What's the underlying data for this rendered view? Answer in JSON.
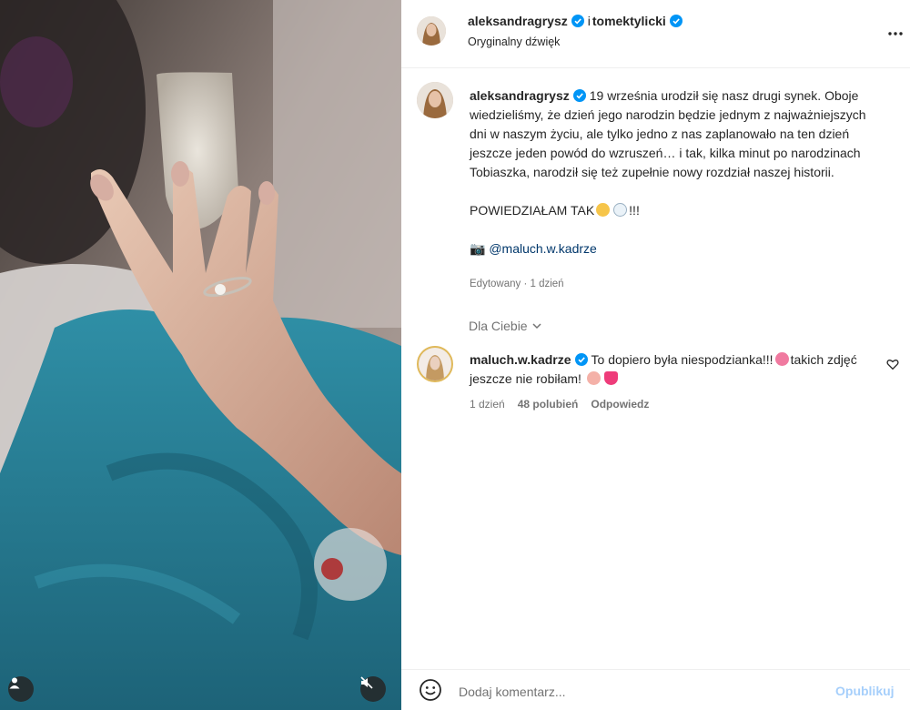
{
  "post": {
    "author": "aleksandragrysz",
    "conjunction": "i",
    "coauthor": "tomektylicki",
    "audio": "Oryginalny dźwięk"
  },
  "caption": {
    "author": "aleksandragrysz",
    "paragraph1": "19 września urodził się nasz drugi synek. Oboje wiedzieliśmy, że dzień jego narodzin będzie jednym z najważniejszych dni w naszym życiu, ale tylko jedno z nas zaplanowało na ten dzień jeszcze jeden powód do wzruszeń… i tak, kilka minut po narodzinach Tobiaszka, narodził się też zupełnie nowy rozdział naszej historii.",
    "paragraph2": "POWIEDZIAŁAM TAK",
    "paragraph2_end": "!!!",
    "camera_emoji": "📷",
    "mention": "@maluch.w.kadrze",
    "edited": "Edytowany · 1 dzień"
  },
  "comments_filter": "Dla Ciebie",
  "comment": {
    "author": "maluch.w.kadrze",
    "text_a": "To dopiero była niespodzianka!!!",
    "text_b": "takich zdjęć jeszcze nie robiłam!",
    "time": "1 dzień",
    "likes": "48 polubień",
    "reply": "Odpowiedz"
  },
  "footer": {
    "placeholder": "Dodaj komentarz...",
    "publish": "Opublikuj"
  },
  "icons": {
    "verified": "verified-badge-icon",
    "more": "more-options-icon",
    "heart": "heart-icon",
    "smile": "emoji-icon",
    "chevron": "chevron-down-icon",
    "user": "user-tag-icon",
    "mute": "audio-muted-icon"
  },
  "colors": {
    "verified": "#0095f6",
    "mention": "#00376b",
    "publish_disabled": "#a6cffb",
    "secondary_text": "#737373"
  }
}
